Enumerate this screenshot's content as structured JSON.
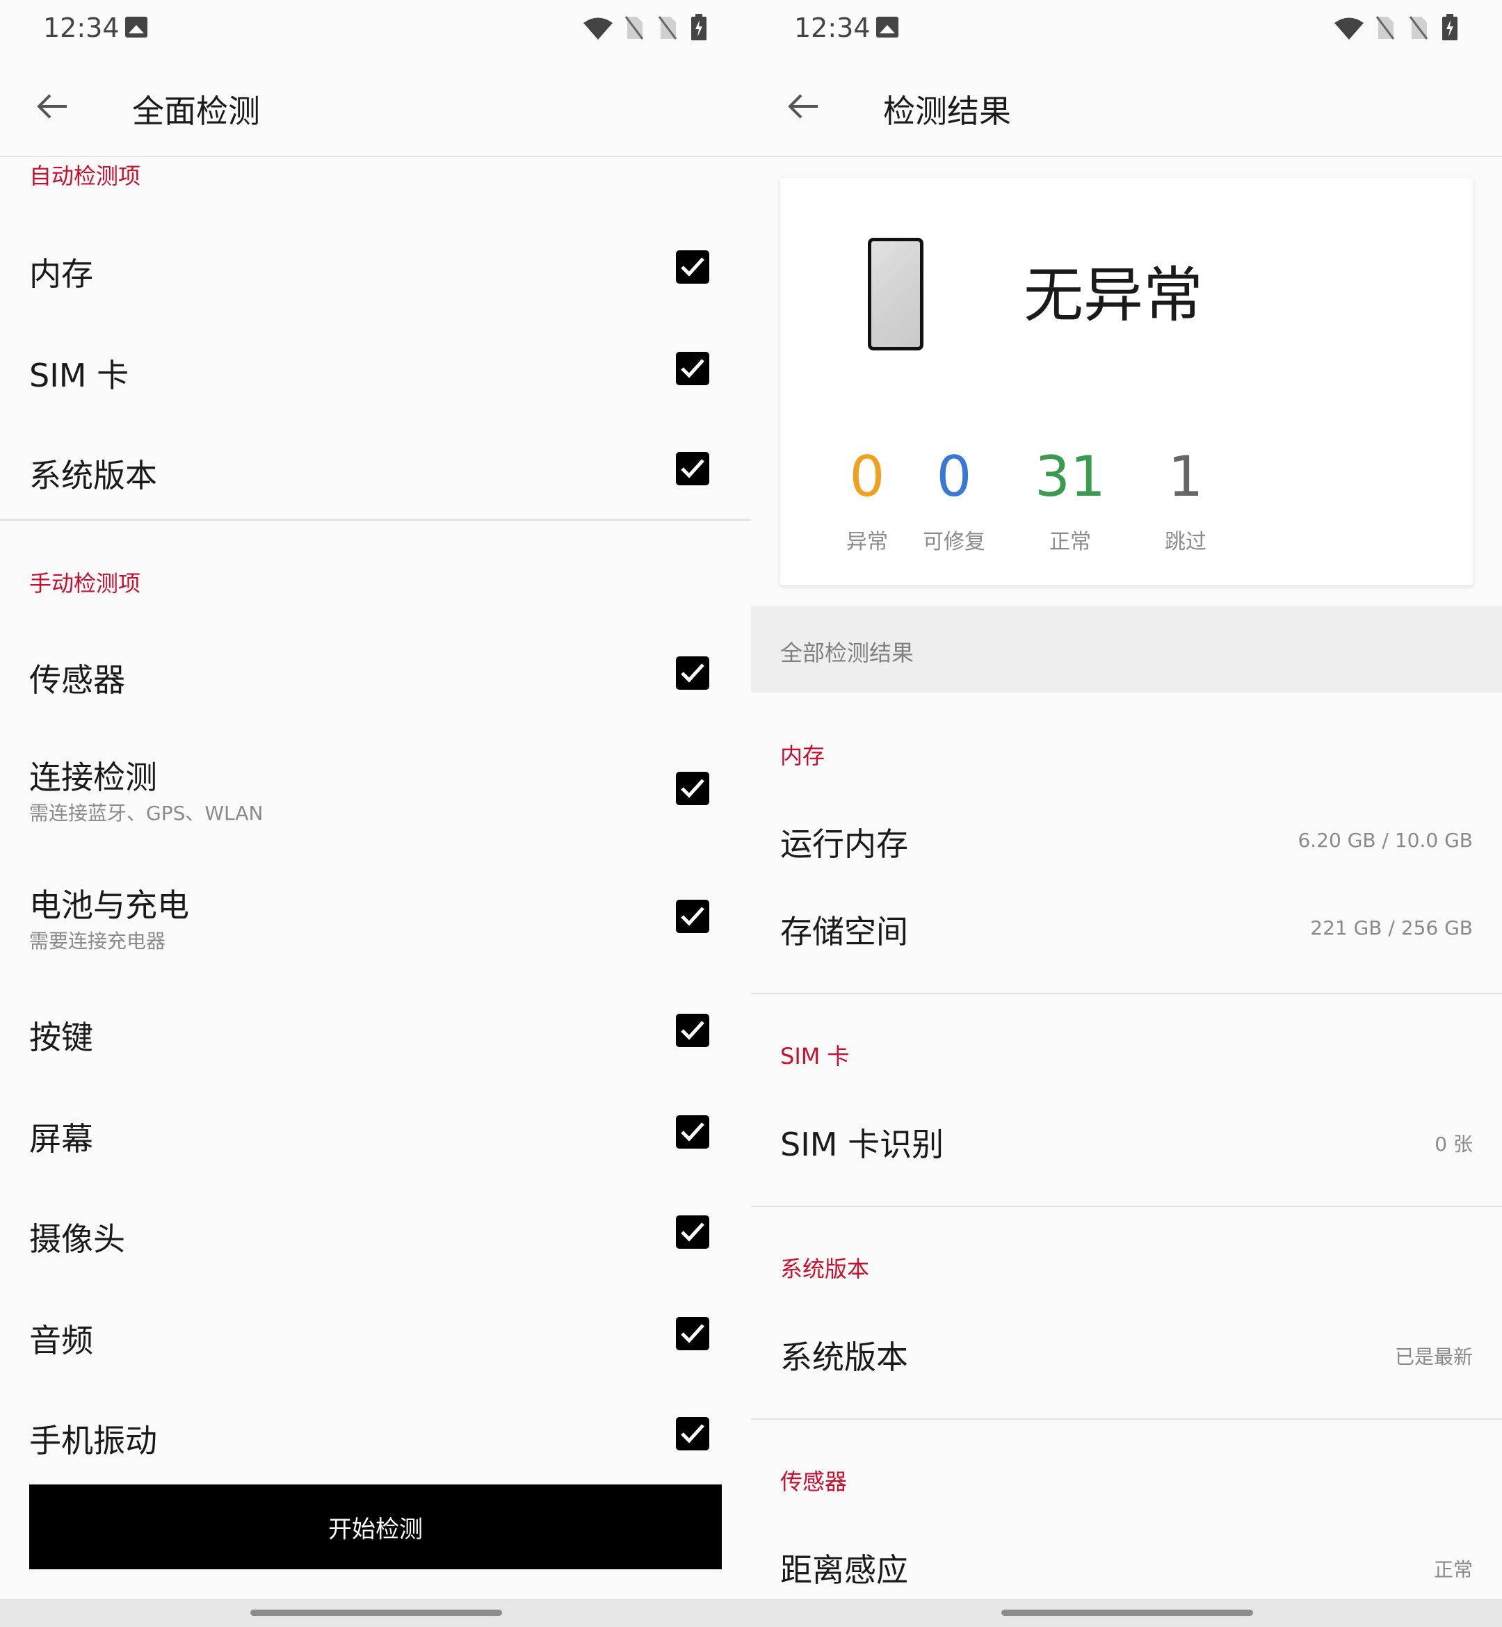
{
  "status_bar": {
    "time": "12:34"
  },
  "left": {
    "title": "全面检测",
    "auto_section": "自动检测项",
    "auto_items": [
      {
        "label": "内存",
        "checked": true
      },
      {
        "label": "SIM 卡",
        "checked": true
      },
      {
        "label": "系统版本",
        "checked": true
      }
    ],
    "manual_section": "手动检测项",
    "manual_items": [
      {
        "label": "传感器",
        "checked": true
      },
      {
        "label": "连接检测",
        "subtitle": "需连接蓝牙、GPS、WLAN",
        "checked": true
      },
      {
        "label": "电池与充电",
        "subtitle": "需要连接充电器",
        "checked": true
      },
      {
        "label": "按键",
        "checked": true
      },
      {
        "label": "屏幕",
        "checked": true
      },
      {
        "label": "摄像头",
        "checked": true
      },
      {
        "label": "音频",
        "checked": true
      },
      {
        "label": "手机振动",
        "checked": true
      }
    ],
    "start_button": "开始检测"
  },
  "right": {
    "title": "检测结果",
    "summary": {
      "status": "无异常",
      "stats": [
        {
          "value": "0",
          "label": "异常",
          "color": "#f0a020"
        },
        {
          "value": "0",
          "label": "可修复",
          "color": "#3a78d8"
        },
        {
          "value": "31",
          "label": "正常",
          "color": "#3a9a4e"
        },
        {
          "value": "1",
          "label": "跳过",
          "color": "#666666"
        }
      ]
    },
    "all_results_label": "全部检测结果",
    "sections": [
      {
        "name": "内存",
        "items": [
          {
            "label": "运行内存",
            "value": "6.20 GB / 10.0 GB"
          },
          {
            "label": "存储空间",
            "value": "221 GB / 256 GB"
          }
        ]
      },
      {
        "name": "SIM 卡",
        "items": [
          {
            "label": "SIM 卡识别",
            "value": "0 张"
          }
        ]
      },
      {
        "name": "系统版本",
        "items": [
          {
            "label": "系统版本",
            "value": "已是最新"
          }
        ]
      },
      {
        "name": "传感器",
        "items": [
          {
            "label": "距离感应",
            "value": "正常"
          }
        ]
      }
    ]
  },
  "colors": {
    "accent": "#c8102e",
    "checkbox": "#000000"
  }
}
